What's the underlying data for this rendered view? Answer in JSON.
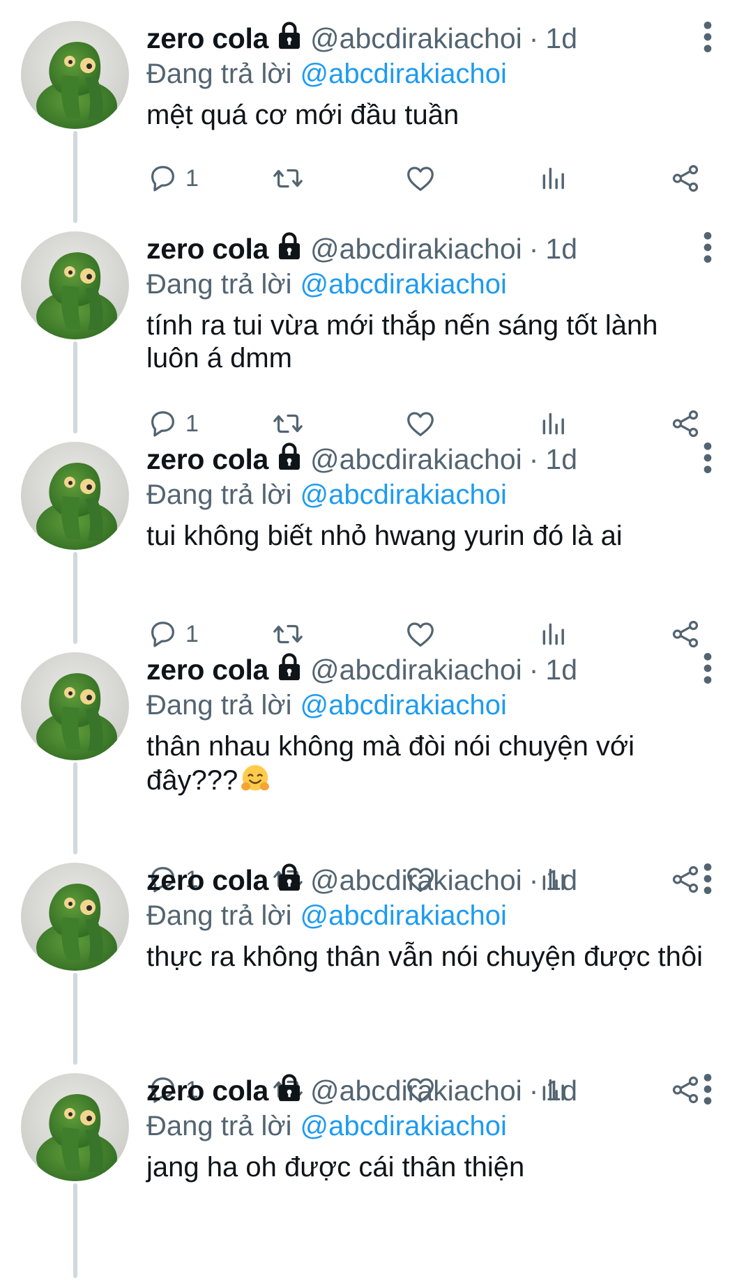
{
  "colors": {
    "text": "#0f1419",
    "secondary": "#536471",
    "link": "#1d9bf0",
    "thread_line": "#cfd9de",
    "background": "#ffffff"
  },
  "icons": {
    "lock": "lock-icon",
    "more": "more-vertical-icon",
    "reply": "reply-icon",
    "retweet": "retweet-icon",
    "like": "heart-icon",
    "views": "views-chart-icon",
    "share": "share-icon",
    "emoji": "hugging-face-emoji"
  },
  "tweets": [
    {
      "display_name": "zero cola",
      "handle": "@abcdirakiachoi",
      "separator": "·",
      "time": "1d",
      "reply_prefix": "Đang trả lời",
      "reply_to": "@abcdirakiachoi",
      "lines": [
        "mệt quá cơ mới đầu tuần"
      ],
      "reply_count": "1"
    },
    {
      "display_name": "zero cola",
      "handle": "@abcdirakiachoi",
      "separator": "·",
      "time": "1d",
      "reply_prefix": "Đang trả lời",
      "reply_to": "@abcdirakiachoi",
      "lines": [
        "tính ra tui vừa mới thắp nến sáng tốt lành",
        "luôn á dmm"
      ],
      "reply_count": "1"
    },
    {
      "display_name": "zero cola",
      "handle": "@abcdirakiachoi",
      "separator": "·",
      "time": "1d",
      "reply_prefix": "Đang trả lời",
      "reply_to": "@abcdirakiachoi",
      "lines": [
        "tui không biết nhỏ hwang yurin đó là ai"
      ],
      "reply_count": "1"
    },
    {
      "display_name": "zero cola",
      "handle": "@abcdirakiachoi",
      "separator": "·",
      "time": "1d",
      "reply_prefix": "Đang trả lời",
      "reply_to": "@abcdirakiachoi",
      "lines": [
        "thân nhau không mà đòi nói chuyện với",
        "đây???"
      ],
      "emoji_after_last_line": "🤗",
      "reply_count": "1"
    },
    {
      "display_name": "zero cola",
      "handle": "@abcdirakiachoi",
      "separator": "·",
      "time": "1d",
      "reply_prefix": "Đang trả lời",
      "reply_to": "@abcdirakiachoi",
      "lines": [
        "thực ra không thân vẫn nói chuyện được thôi"
      ],
      "reply_count": "1"
    },
    {
      "display_name": "zero cola",
      "handle": "@abcdirakiachoi",
      "separator": "·",
      "time": "1d",
      "reply_prefix": "Đang trả lời",
      "reply_to": "@abcdirakiachoi",
      "lines": [
        "jang ha oh được cái thân thiện"
      ],
      "reply_count": null
    }
  ]
}
